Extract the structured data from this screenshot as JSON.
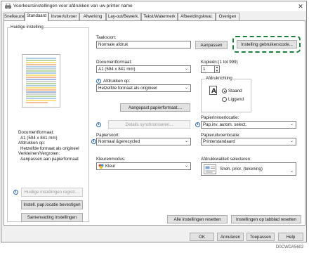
{
  "window": {
    "title": "Voorkeursinstellingen voor afdrukken van uw printer name"
  },
  "tabs": [
    "Snelkeuzes",
    "Standaard",
    "Invoer/uitvoer",
    "Afwerking",
    "Lay-out/Bewerk.",
    "Tekst/Watermerk",
    "Afbeeldingskwal.",
    "Overigen"
  ],
  "active_tab": "Standaard",
  "current_setting": {
    "legend": "Huidige instelling",
    "summary_lines": [
      "Documentformaat:",
      "A1 (594 x 841 mm)",
      "Afdrukken op:",
      "Hetzelfde formaat als origineel",
      "Verkleinen/Vergroten:",
      "Aanpassen aan papierformaat"
    ],
    "register_button": "Huidige instellingen registr....",
    "paper_position_button": "Instell. pap.locatie bevestigen",
    "summary_button": "Samenvatting instellingen"
  },
  "job_type": {
    "label": "Taaksoort:",
    "value": "Normale afdruk",
    "adjust_button": "Aanpassen",
    "user_code_button": "Instelling gebruikerscode..."
  },
  "document_size": {
    "label": "Documentformaat:",
    "value": "A1 (594 x 841 mm)"
  },
  "copies": {
    "label": "Kopieën:(1 tot 999)",
    "value": "1"
  },
  "print_on": {
    "label": "Afdrukken op:",
    "value": "Hetzelfde formaat als origineel"
  },
  "orientation": {
    "legend": "Afdrukrichting",
    "options": [
      "Staand",
      "Liggend"
    ],
    "selected": "Staand"
  },
  "custom_paper_button": "Aangepast papierformaat....",
  "sync_button": "Details synchroniseren...",
  "input_tray": {
    "label": "Papierinvoerlocatie:",
    "value": "Pap.inv. autom. select."
  },
  "paper_type": {
    "label": "Papiersoort:",
    "value": "Normaal &gerecycled"
  },
  "output_tray": {
    "label": "Papieruitvoerlocatie:",
    "value": "Printerstandaard"
  },
  "color_mode": {
    "label": "Kleurenmodus:",
    "value": "Kleur"
  },
  "print_quality": {
    "label": "Afdrukkwaliteit selecteren:",
    "value": "Sneh. prior. (tekening)"
  },
  "reset_all_button": "Alle instellingen resetten",
  "reset_tab_button": "Instellingen op tabblad resetten",
  "footer": {
    "ok": "OK",
    "cancel": "Annuleren",
    "apply": "Toepassen",
    "help": "Help"
  },
  "caption": "D0CWDA5602",
  "colors": {
    "highlight": "#18813a",
    "info": "#2b6cb0"
  }
}
